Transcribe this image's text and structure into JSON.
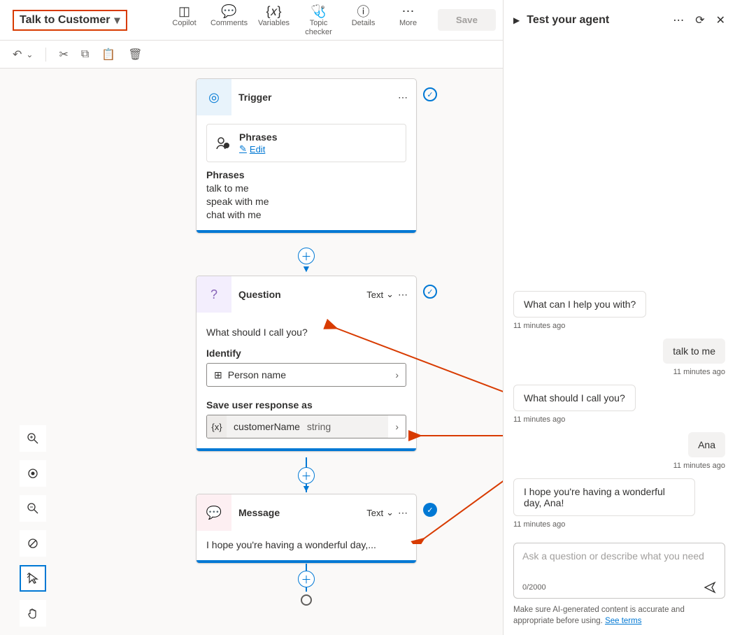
{
  "topbar": {
    "title": "Talk to Customer",
    "items": {
      "copilot": "Copilot",
      "comments": "Comments",
      "variables": "Variables",
      "topic_checker_l1": "Topic",
      "topic_checker_l2": "checker",
      "details": "Details",
      "more": "More"
    },
    "save": "Save"
  },
  "canvas": {
    "trigger": {
      "title": "Trigger",
      "phrases_label": "Phrases",
      "edit": "Edit",
      "phrases_header": "Phrases",
      "items": [
        "talk to me",
        "speak with me",
        "chat with me"
      ]
    },
    "question": {
      "title": "Question",
      "type": "Text",
      "prompt": "What should I call you?",
      "identify_label": "Identify",
      "identify_value": "Person name",
      "save_as_label": "Save user response as",
      "var_name": "customerName",
      "var_type": "string"
    },
    "message": {
      "title": "Message",
      "type": "Text",
      "text": "I hope you're having a wonderful day,..."
    }
  },
  "test": {
    "header": "Test your agent",
    "messages": [
      {
        "who": "bot",
        "text": "What can I help you with?",
        "ts": "11 minutes ago"
      },
      {
        "who": "user",
        "text": "talk to me",
        "ts": "11 minutes ago"
      },
      {
        "who": "bot",
        "text": "What should I call you?",
        "ts": "11 minutes ago"
      },
      {
        "who": "user",
        "text": "Ana",
        "ts": "11 minutes ago"
      },
      {
        "who": "bot",
        "text": "I hope you're having a wonderful day, Ana!",
        "ts": "11 minutes ago"
      }
    ],
    "input_placeholder": "Ask a question or describe what you need",
    "counter": "0/2000",
    "disclaimer": "Make sure AI-generated content is accurate and appropriate before using. ",
    "see_terms": "See terms"
  }
}
